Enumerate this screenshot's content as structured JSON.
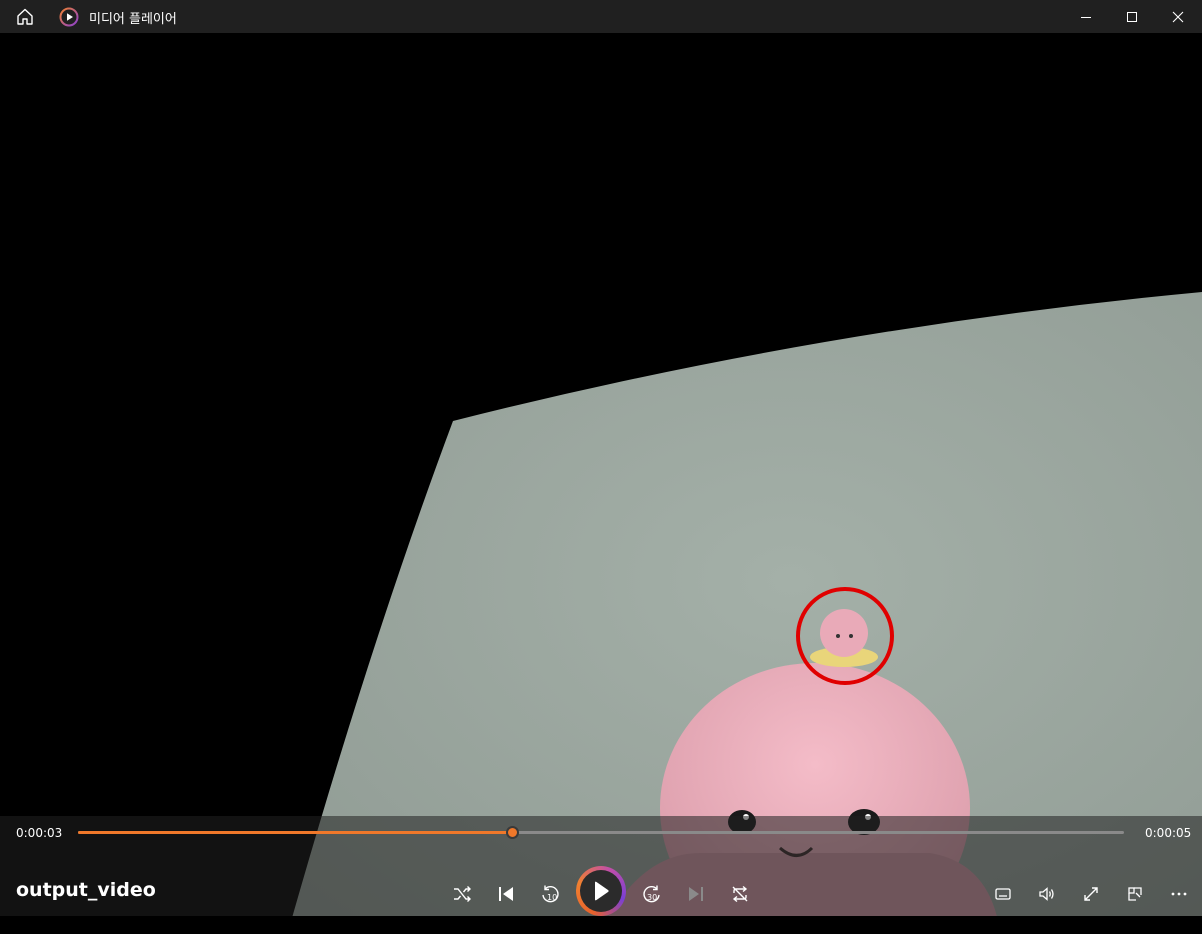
{
  "app": {
    "title": "미디어 플레이어"
  },
  "player": {
    "video_name": "output_video",
    "current_time": "0:00:03",
    "duration": "0:00:05",
    "progress_fraction": 0.415
  },
  "controls": {
    "shuffle_icon": "shuffle-icon",
    "previous_icon": "previous-icon",
    "rewind_label": "10",
    "play_icon": "play-icon",
    "forward_label": "30",
    "next_icon": "next-icon",
    "repeat_icon": "repeat-off-icon",
    "captions_icon": "captions-icon",
    "volume_icon": "volume-icon",
    "fullscreen_icon": "fullscreen-icon",
    "miniplayer_icon": "miniplayer-icon",
    "more_icon": "more-icon"
  },
  "colors": {
    "accent": "#f0782a",
    "titlebar": "#202020",
    "annotation_circle": "#e00000"
  }
}
